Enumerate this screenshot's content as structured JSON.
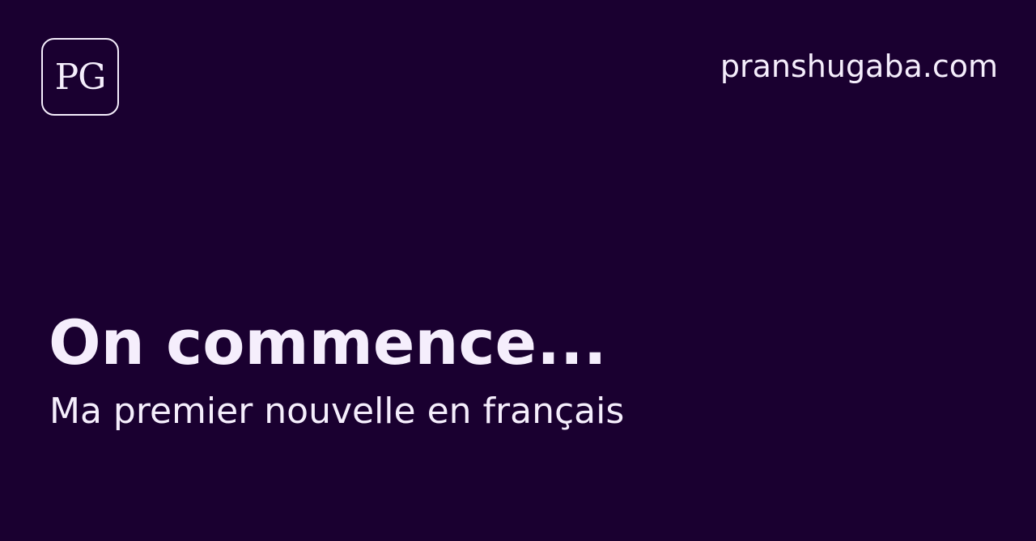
{
  "header": {
    "logo": {
      "text": "PG"
    },
    "site_url": "pranshugaba.com"
  },
  "main": {
    "title": "On commence...",
    "subtitle": "Ma premier nouvelle en français"
  },
  "colors": {
    "background": "#1a0030",
    "foreground": "#f5eefc"
  }
}
